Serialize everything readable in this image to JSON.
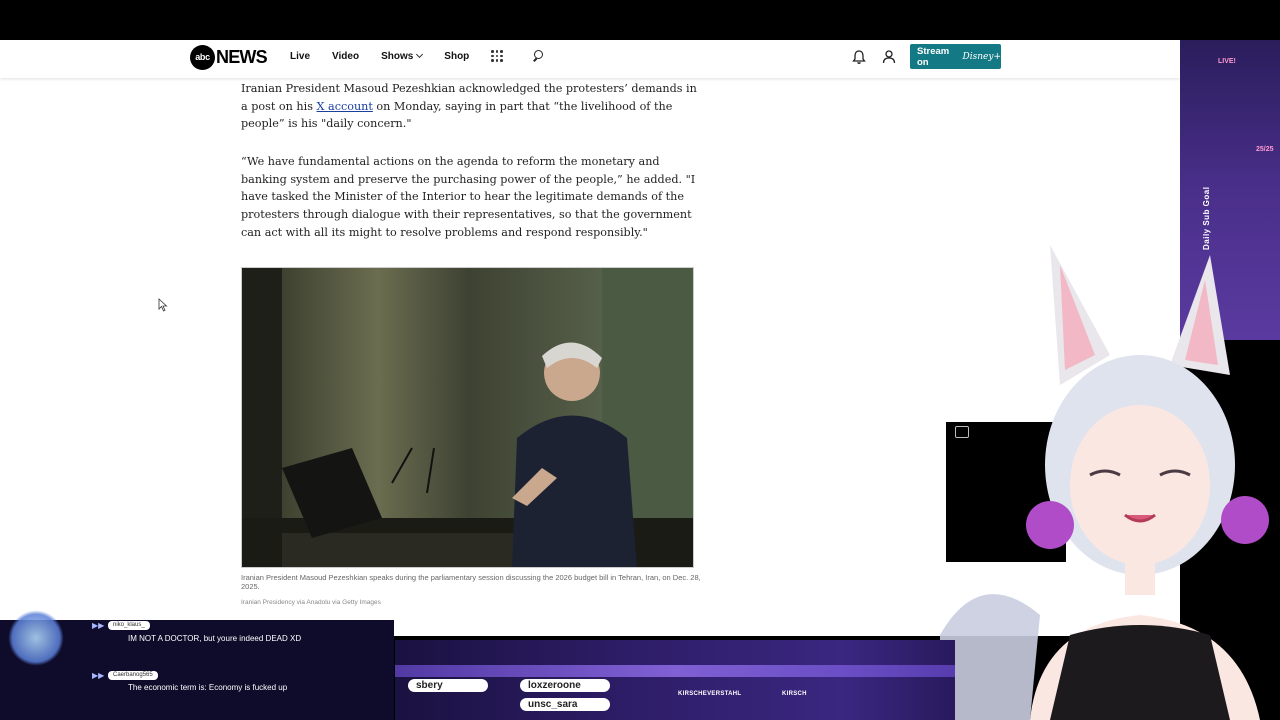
{
  "header": {
    "logo_abc": "abc",
    "logo_news": "NEWS",
    "nav": [
      "Live",
      "Video",
      "Shows",
      "Shop"
    ],
    "stream_label": "Stream on",
    "stream_brand": "Disney+"
  },
  "article": {
    "p1_a": "Iranian President Masoud Pezeshkian acknowledged the protesters’ demands in a post on his ",
    "p1_link": "X account",
    "p1_b": " on Monday, saying in part that “the livelihood of the people” is his \"daily concern.\"",
    "p2": "“We have fundamental actions on the agenda to reform the monetary and banking system and preserve the purchasing power of the people,” he added. \"I have tasked the Minister of the Interior to hear the legitimate demands of the protesters through dialogue with their representatives, so that the government can act with all its might to resolve problems and respond responsibly.\"",
    "caption": "Iranian President Masoud Pezeshkian speaks during the parliamentary session discussing the 2026 budget bill in Tehran, Iran, on Dec. 28, 2025.",
    "credit": "Iranian Presidency via Anadolu via Getty Images"
  },
  "stream_overlay": {
    "live_badge": "LIVE!",
    "goal_count": "25/25",
    "goal_label": "Daily Sub Goal",
    "ticker_names": [
      "sbery",
      "loxzeroone",
      "unsc_sara"
    ],
    "channel_tag": "KIRSCHEVERSTAHL",
    "channel_tag2": "KIRSCH"
  },
  "chat": [
    {
      "user": "niko_klaus_",
      "message": "IM NOT A DOCTOR, but youre indeed DEAD XD"
    },
    {
      "user": "Caerbanog565",
      "message": "The economic term is: Economy is fucked up"
    }
  ],
  "colors": {
    "stream_button": "#137a85",
    "link": "#1c3f9e",
    "overlay_purple": "#3a2780"
  }
}
